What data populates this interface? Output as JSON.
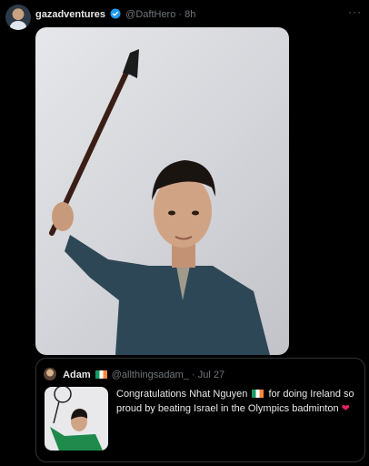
{
  "post": {
    "display_name": "gazadventures",
    "handle": "@DaftHero",
    "separator": "·",
    "time": "8h",
    "more_label": "···"
  },
  "quote": {
    "display_name": "Adam",
    "handle": "@allthingsadam_",
    "separator": "·",
    "date": "Jul 27",
    "text_before_flag": "Congratulations Nhat Nguyen",
    "text_after_flag": "for doing Ireland so proud by beating Israel in the Olympics badminton",
    "heart": "❤"
  },
  "colors": {
    "background": "#000000",
    "verified": "#1d9bf0",
    "muted": "#71767b",
    "heart": "#e0245e"
  },
  "icons": [
    "verified-badge-icon",
    "more-options-icon",
    "ireland-flag-icon",
    "heart-icon"
  ]
}
